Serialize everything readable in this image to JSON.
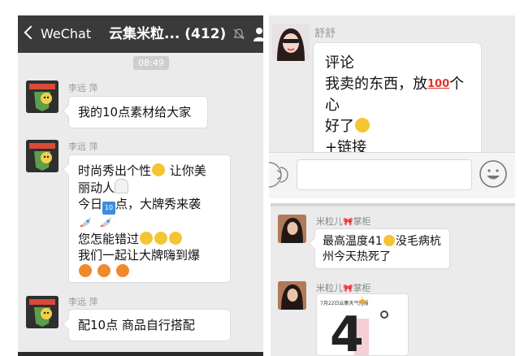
{
  "left_chat": {
    "back_label": "WeChat",
    "title": "云集米粒... (412)",
    "time": "08:49",
    "messages": [
      {
        "sender": "李远 萍",
        "lines": [
          "我的10点素材给大家"
        ]
      },
      {
        "sender": "李远 萍",
        "lines": [
          "时尚秀出个性",
          "让你美",
          "丽动人",
          "今日",
          "点，大牌秀来袭",
          "您怎能错过",
          "我们一起让大牌嗨到爆"
        ]
      },
      {
        "sender": "李远 萍",
        "lines": [
          "配10点  商品自行搭配"
        ]
      }
    ],
    "keycap_10": "10"
  },
  "right_top_chat": {
    "sender": "舒舒",
    "bubble_lines": [
      "评论",
      "我卖的东西，放",
      "个心",
      "好了",
      "+链接"
    ],
    "hundred_emoji_text": "100"
  },
  "right_bottom_chat": {
    "sender_name": "米粒儿",
    "sender_bow": "🎀",
    "sender_suffix": "掌柜",
    "messages": [
      {
        "lines": [
          "最高温度41",
          "没毛病杭",
          "州今天热死了"
        ]
      }
    ],
    "weather_card": {
      "caption": "7月22日云集天气预报",
      "temperature": "4"
    }
  },
  "colors": {
    "topbar": "#3a3a3a",
    "chat_bg": "#ebebeb",
    "bubble": "#ffffff",
    "emoji_yellow": "#f4c433",
    "emoji_orange": "#f08a2c",
    "keycap_blue": "#3d8ddb",
    "hundred_red": "#e5322d"
  },
  "icons": [
    "back-chevron-icon",
    "mute-bell-icon",
    "person-icon",
    "voice-icon",
    "emoji-smile-icon",
    "sun-icon",
    "rocket-icon",
    "ghost-icon",
    "hundred-icon"
  ]
}
